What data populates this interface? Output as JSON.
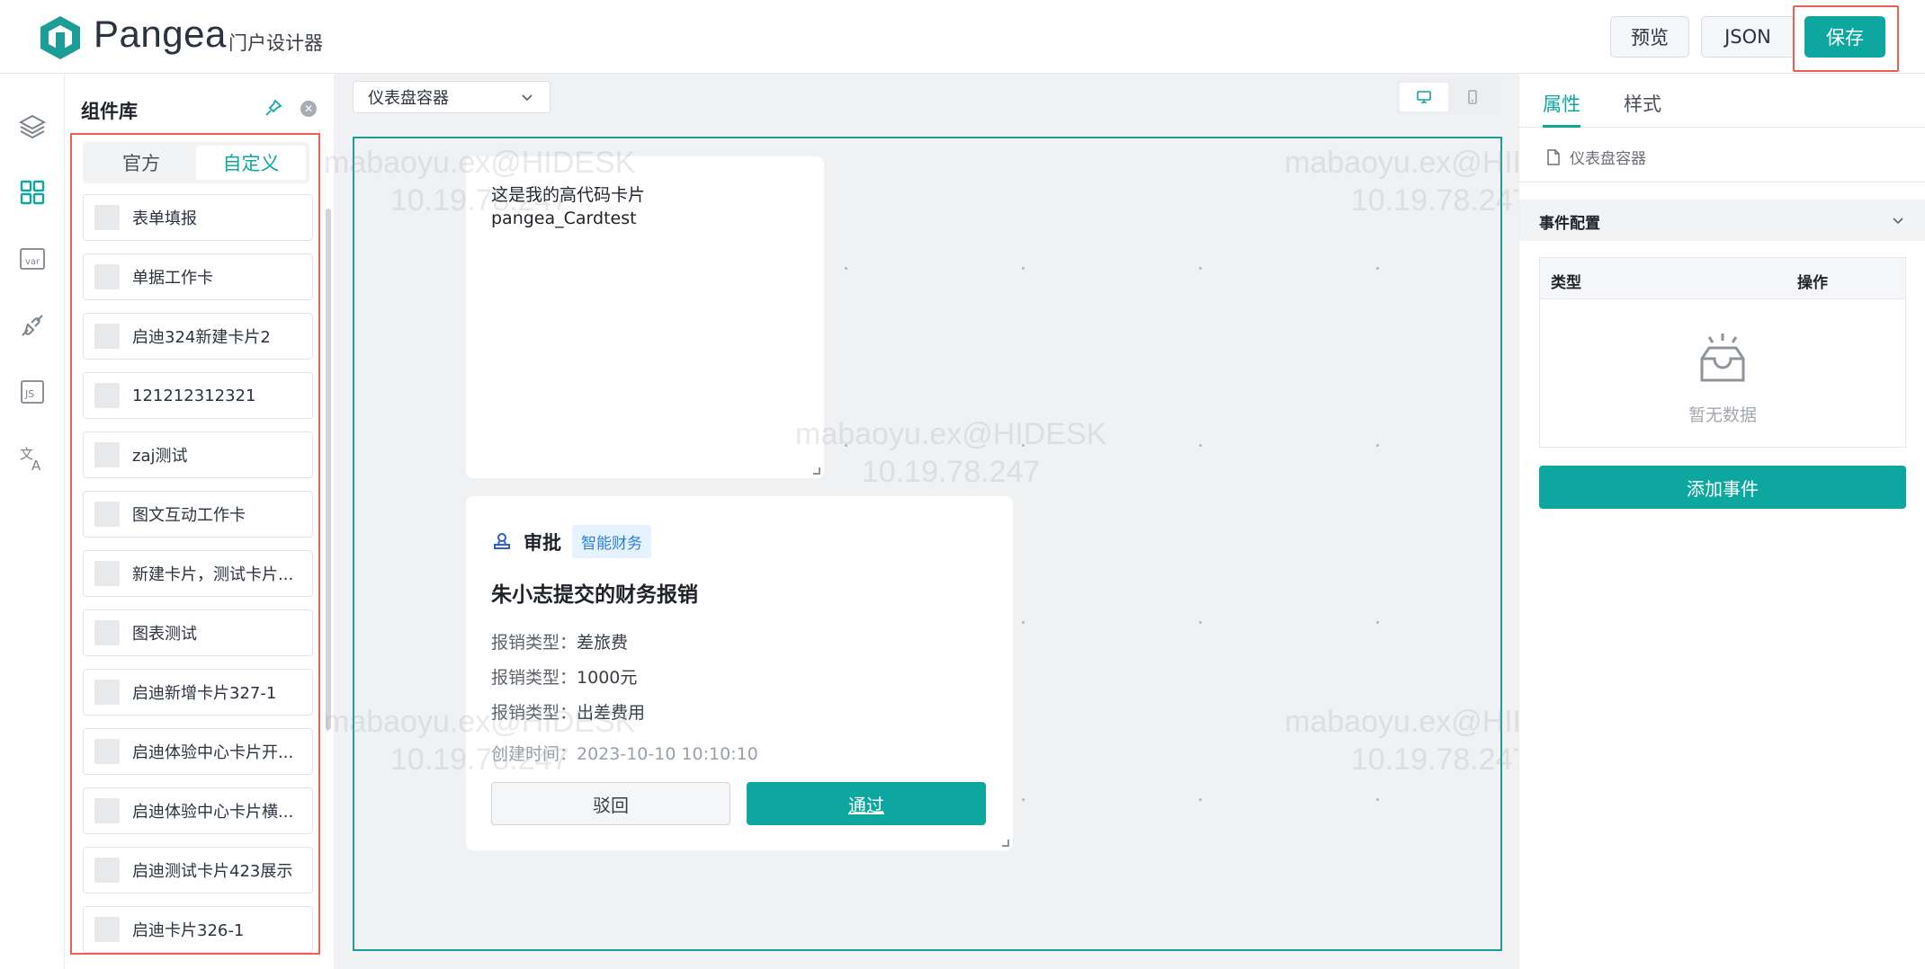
{
  "header": {
    "brand": "Pangea",
    "subtitle": "门户设计器",
    "preview_label": "预览",
    "json_label": "JSON",
    "save_label": "保存"
  },
  "rail": {
    "icons": [
      "layers-icon",
      "grid-icon",
      "variable-icon",
      "plug-icon",
      "js-icon",
      "translate-icon"
    ]
  },
  "library": {
    "title": "组件库",
    "tabs": [
      {
        "label": "官方",
        "active": false
      },
      {
        "label": "自定义",
        "active": true
      }
    ],
    "items": [
      "表单填报",
      "单据工作卡",
      "启迪324新建卡片2",
      "121212312321",
      "zaj测试",
      "图文互动工作卡",
      "新建卡片，测试卡片...",
      "图表测试",
      "启迪新增卡片327-1",
      "启迪体验中心卡片开...",
      "启迪体验中心卡片横...",
      "启迪测试卡片423展示",
      "启迪卡片326-1"
    ]
  },
  "canvas": {
    "container_select": "仪表盘容器",
    "card1": {
      "line1": "这是我的高代码卡片",
      "line2": "pangea_Cardtest"
    },
    "card2": {
      "type": "审批",
      "tag": "智能财务",
      "title": "朱小志提交的财务报销",
      "rows": [
        {
          "key": "报销类型：",
          "value": "差旅费"
        },
        {
          "key": "报销类型：",
          "value": "1000元"
        },
        {
          "key": "报销类型：",
          "value": "出差费用"
        }
      ],
      "created": "创建时间：2023-10-10 10:10:10",
      "reject_label": "驳回",
      "pass_label": "通过"
    },
    "watermark_line1": "mabaoyu.ex@HIDESK",
    "watermark_line2": "10.19.78.247"
  },
  "props": {
    "tabs": [
      {
        "label": "属性",
        "active": true
      },
      {
        "label": "样式",
        "active": false
      }
    ],
    "component_name": "仪表盘容器",
    "event_section_title": "事件配置",
    "table_headers": [
      "类型",
      "操作"
    ],
    "empty_text": "暂无数据",
    "add_event_label": "添加事件"
  },
  "colors": {
    "accent": "#0ea7a0",
    "highlight_frame": "#ee5f4f",
    "tag_bg": "#e6f2ff",
    "tag_text": "#2d7ee0"
  }
}
